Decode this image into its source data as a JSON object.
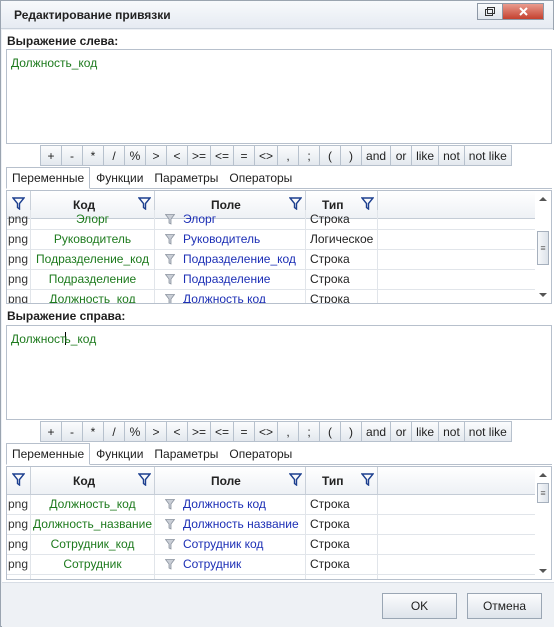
{
  "window": {
    "title": "Редактирование привязки"
  },
  "left_expr": {
    "label": "Выражение слева:",
    "value": "Должность_код"
  },
  "right_expr": {
    "label": "Выражение справа:",
    "value_before_caret": "Должност",
    "value_after_caret": "ь_код"
  },
  "operators": [
    "+",
    "-",
    "*",
    "/",
    "%",
    ">",
    "<",
    ">=",
    "<=",
    "=",
    "<>",
    ",",
    ";",
    "(",
    ")",
    "and",
    "or",
    "like",
    "not",
    "not like"
  ],
  "tabs": [
    "Переменные",
    "Функции",
    "Параметры",
    "Операторы"
  ],
  "grid_headers": {
    "kod": "Код",
    "pole": "Поле",
    "tip": "Тип"
  },
  "grid_top": {
    "rows": [
      {
        "c0": "png",
        "kod": "Элорг",
        "pole": "Элорг",
        "tip": "Строка"
      },
      {
        "c0": "png",
        "kod": "Руководитель",
        "pole": "Руководитель",
        "tip": "Логическое"
      },
      {
        "c0": "png",
        "kod": "Подразделение_код",
        "pole": "Подразделение_код",
        "tip": "Строка"
      },
      {
        "c0": "png",
        "kod": "Подразделение",
        "pole": "Подразделение",
        "tip": "Строка"
      },
      {
        "c0": "png",
        "kod": "Должность_код",
        "pole": "Должность код",
        "tip": "Строка"
      }
    ]
  },
  "grid_bottom": {
    "rows": [
      {
        "c0": "png",
        "kod": "Должность_код",
        "pole": "Должность код",
        "tip": "Строка"
      },
      {
        "c0": "png",
        "kod": "Должность_название",
        "pole": "Должность название",
        "tip": "Строка"
      },
      {
        "c0": "png",
        "kod": "Сотрудник_код",
        "pole": "Сотрудник код",
        "tip": "Строка"
      },
      {
        "c0": "png",
        "kod": "Сотрудник",
        "pole": "Сотрудник",
        "tip": "Строка"
      },
      {
        "c0": "png",
        "kod": "",
        "pole": "",
        "tip": ""
      }
    ]
  },
  "buttons": {
    "ok": "OK",
    "cancel": "Отмена"
  },
  "colors": {
    "code_text": "#1d7a1d",
    "field_text": "#1c2fb5",
    "close_button": "#c4412f"
  }
}
